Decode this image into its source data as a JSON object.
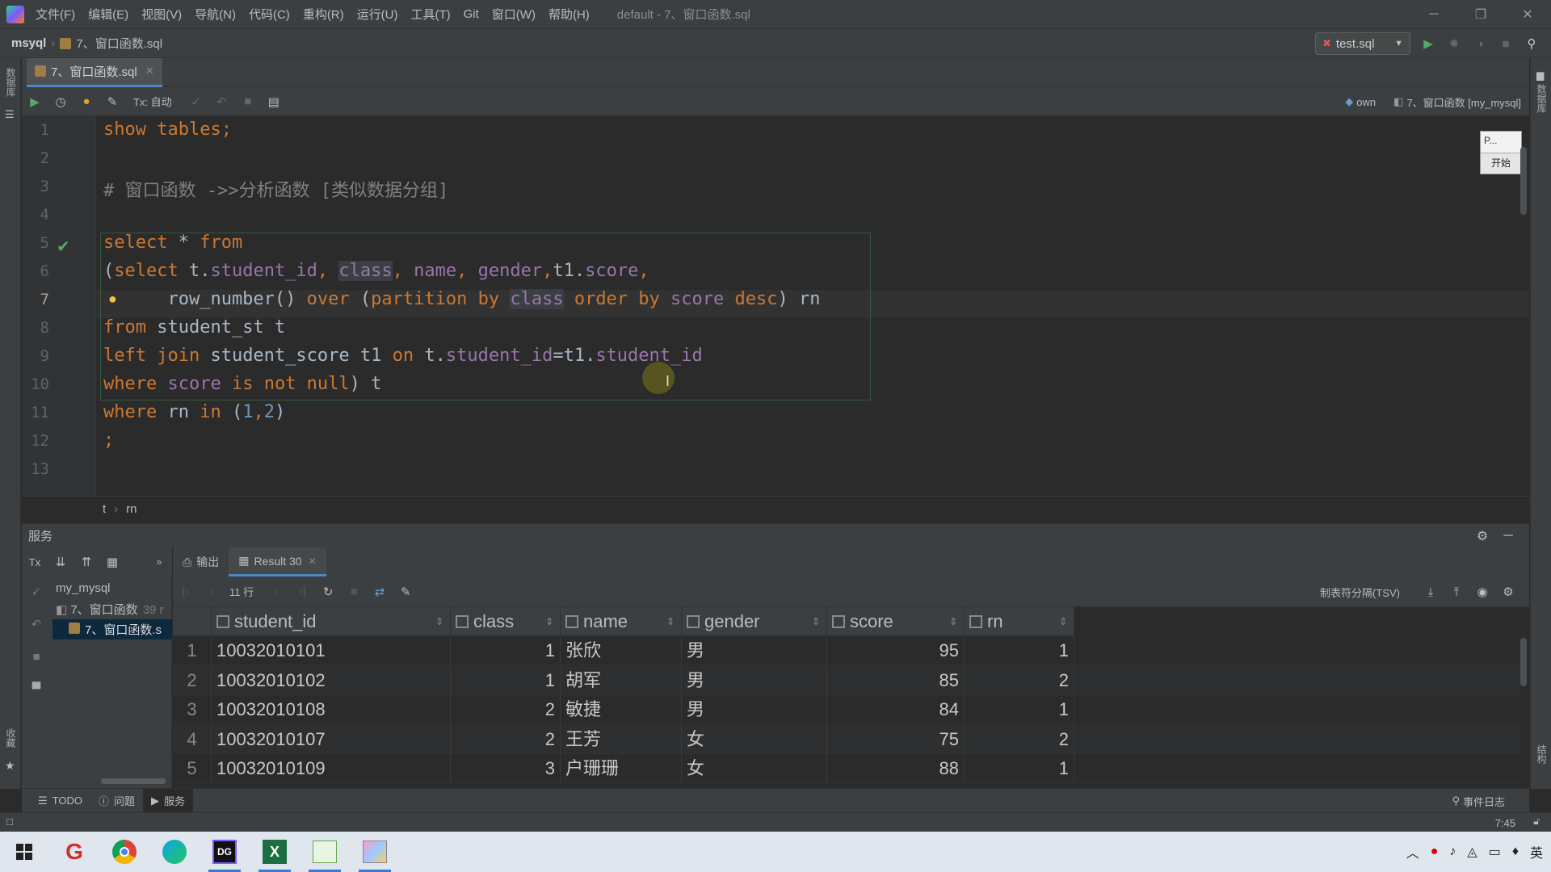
{
  "menu": {
    "items": [
      "文件(F)",
      "编辑(E)",
      "视图(V)",
      "导航(N)",
      "代码(C)",
      "重构(R)",
      "运行(U)",
      "工具(T)",
      "Git",
      "窗口(W)",
      "帮助(H)"
    ],
    "window_title": "default - 7、窗口函数.sql"
  },
  "navbar": {
    "root": "msyql",
    "file": "7、窗口函数.sql",
    "run_config": "test.sql"
  },
  "left_strip": {
    "top_label": "数据库",
    "bottom_label": "收藏"
  },
  "right_strip": {
    "top_label": "数据库",
    "bottom_label": "结构"
  },
  "editor_tab": {
    "label": "7、窗口函数.sql"
  },
  "editor_toolbar": {
    "tx_label": "Tx: 自动",
    "schema": "own",
    "console": "7、窗口函数 [my_mysql]"
  },
  "editor": {
    "line_numbers": [
      "1",
      "2",
      "3",
      "4",
      "5",
      "6",
      "7",
      "8",
      "9",
      "10",
      "11",
      "12",
      "13"
    ],
    "current_line": 7,
    "lines": [
      [
        {
          "t": "show tables;",
          "c": "kw"
        }
      ],
      [],
      [
        {
          "t": "# 窗口函数 ->>分析函数 [类似数据分组]",
          "c": "cm"
        }
      ],
      [],
      [
        {
          "t": "select ",
          "c": "kw"
        },
        {
          "t": "* ",
          "c": "pl"
        },
        {
          "t": "from",
          "c": "kw"
        }
      ],
      [
        {
          "t": "(",
          "c": "pl"
        },
        {
          "t": "select ",
          "c": "kw"
        },
        {
          "t": "t.",
          "c": "pl"
        },
        {
          "t": "student_id",
          "c": "id"
        },
        {
          "t": ", ",
          "c": "kw"
        },
        {
          "t": "class",
          "c": "id hl"
        },
        {
          "t": ", ",
          "c": "kw"
        },
        {
          "t": "name",
          "c": "id"
        },
        {
          "t": ", ",
          "c": "kw"
        },
        {
          "t": "gender",
          "c": "id"
        },
        {
          "t": ",",
          "c": "kw"
        },
        {
          "t": "t1.",
          "c": "pl"
        },
        {
          "t": "score",
          "c": "id"
        },
        {
          "t": ",",
          "c": "kw"
        }
      ],
      [
        {
          "t": "      row_number",
          "c": "pl"
        },
        {
          "t": "() ",
          "c": "pl"
        },
        {
          "t": "over ",
          "c": "kw"
        },
        {
          "t": "(",
          "c": "pl"
        },
        {
          "t": "partition by ",
          "c": "kw"
        },
        {
          "t": "class",
          "c": "id hl"
        },
        {
          "t": " order by ",
          "c": "kw"
        },
        {
          "t": "score ",
          "c": "id"
        },
        {
          "t": "desc",
          "c": "kw"
        },
        {
          "t": ") rn",
          "c": "pl"
        }
      ],
      [
        {
          "t": "from ",
          "c": "kw"
        },
        {
          "t": "student_st t",
          "c": "pl"
        }
      ],
      [
        {
          "t": "left join ",
          "c": "kw"
        },
        {
          "t": "student_score t1 ",
          "c": "pl"
        },
        {
          "t": "on ",
          "c": "kw"
        },
        {
          "t": "t.",
          "c": "pl"
        },
        {
          "t": "student_id",
          "c": "id"
        },
        {
          "t": "=t1.",
          "c": "pl"
        },
        {
          "t": "student_id",
          "c": "id"
        }
      ],
      [
        {
          "t": "where ",
          "c": "kw"
        },
        {
          "t": "score ",
          "c": "id"
        },
        {
          "t": "is not null",
          "c": "kw"
        },
        {
          "t": ") t",
          "c": "pl"
        }
      ],
      [
        {
          "t": "where ",
          "c": "kw"
        },
        {
          "t": "rn ",
          "c": "pl"
        },
        {
          "t": "in ",
          "c": "kw"
        },
        {
          "t": "(",
          "c": "pl"
        },
        {
          "t": "1",
          "c": "num"
        },
        {
          "t": ",",
          "c": "kw"
        },
        {
          "t": "2",
          "c": "num"
        },
        {
          "t": ")",
          "c": "pl"
        }
      ],
      [
        {
          "t": ";",
          "c": "kw"
        }
      ],
      []
    ],
    "mini_window": {
      "label": "P...",
      "start_button": "开始"
    }
  },
  "breadcrumb": {
    "items": [
      "t",
      "rn"
    ]
  },
  "services": {
    "title": "服务",
    "tree": {
      "root": "my_mysql",
      "child": "7、窗口函数",
      "child_count": "39 r",
      "leaf": "7、窗口函数.s"
    },
    "tabs": [
      {
        "label": "输出"
      },
      {
        "label": "Result 30"
      }
    ],
    "row_count": "11 行",
    "export_format": "制表符分隔(TSV)",
    "columns": [
      "student_id",
      "class",
      "name",
      "gender",
      "score",
      "rn"
    ],
    "rows": [
      [
        "1",
        "10032010101",
        "1",
        "张欣",
        "男",
        "95",
        "1"
      ],
      [
        "2",
        "10032010102",
        "1",
        "胡军",
        "男",
        "85",
        "2"
      ],
      [
        "3",
        "10032010108",
        "2",
        "敏捷",
        "男",
        "84",
        "1"
      ],
      [
        "4",
        "10032010107",
        "2",
        "王芳",
        "女",
        "75",
        "2"
      ],
      [
        "5",
        "10032010109",
        "3",
        "户珊珊",
        "女",
        "88",
        "1"
      ]
    ]
  },
  "bottom_tabs": [
    {
      "label": "TODO"
    },
    {
      "label": "问题"
    },
    {
      "label": "服务"
    }
  ],
  "event_log": "事件日志",
  "status_time": "7:45",
  "tray_ime": "英",
  "colors": {
    "keyword": "#cc7832",
    "identifier": "#9876aa",
    "number": "#6897bb",
    "accent": "#4a88c7"
  }
}
